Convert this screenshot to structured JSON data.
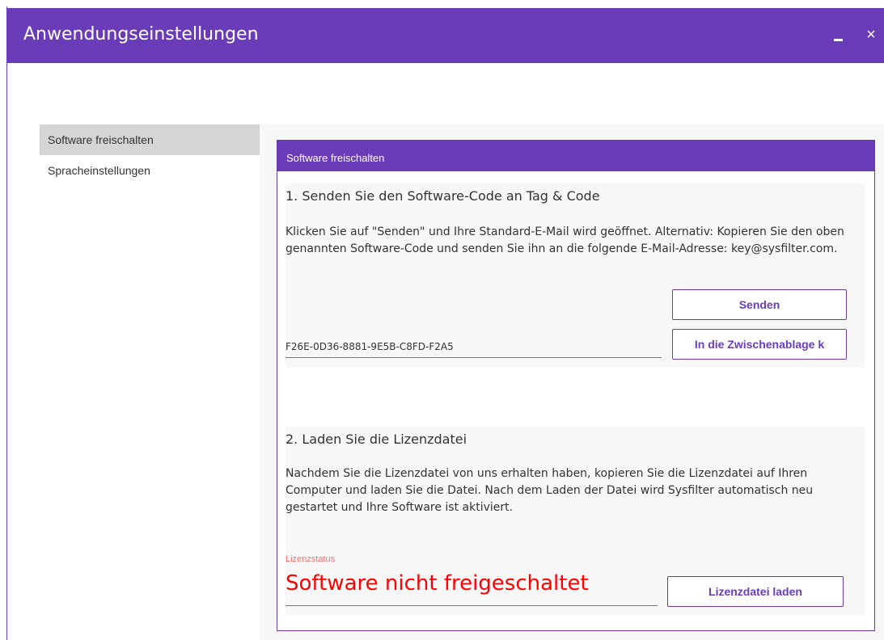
{
  "window": {
    "title": "Anwendungseinstellungen",
    "minimize_glyph": "",
    "close_glyph": "×",
    "accent_color": "#6a3cb7"
  },
  "sidebar": {
    "items": [
      {
        "label": "Software freischalten",
        "active": true
      },
      {
        "label": "Spracheinstellungen",
        "active": false
      }
    ]
  },
  "panel": {
    "header": "Software freischalten",
    "step1": {
      "title": "1. Senden Sie den Software-Code an Tag & Code",
      "description": "Klicken Sie auf \"Senden\" und Ihre Standard-E-Mail wird geöffnet. Alternativ: Kopieren Sie den oben genannten Software-Code und senden Sie ihn an die folgende E-Mail-Adresse: key@sysfilter.com.",
      "send_button": "Senden",
      "clipboard_button": "In die Zwischenablage k",
      "software_code": "F26E-0D36-8881-9E5B-C8FD-F2A5"
    },
    "step2": {
      "title": "2. Laden Sie die Lizenzdatei",
      "description": "Nachdem Sie die Lizenzdatei von uns erhalten haben, kopieren Sie die Lizenzdatei auf Ihren Computer und laden Sie die Datei. Nach dem Laden der Datei wird Sysfilter automatisch neu gestartet und Ihre Software ist aktiviert.",
      "status_label": "Lizenzstatus",
      "status_value": "Software nicht freigeschaltet",
      "status_color": "#ff0000",
      "load_button": "Lizenzdatei laden"
    }
  }
}
